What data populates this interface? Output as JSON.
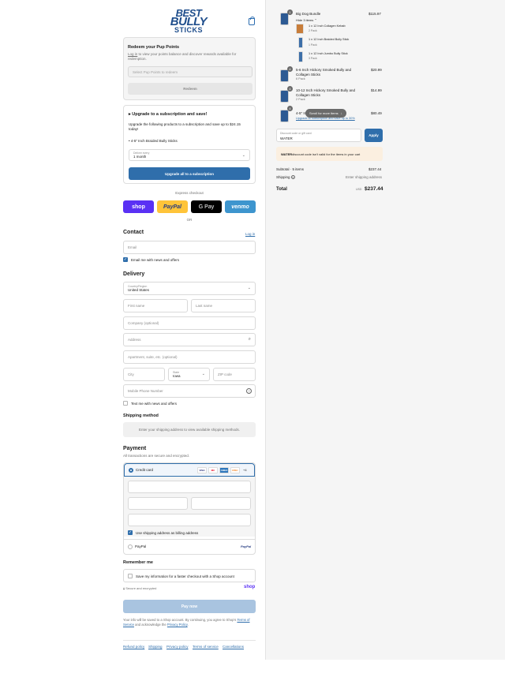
{
  "brand": {
    "line1": "BEST",
    "line2": "BULLY",
    "line3": "STICKS"
  },
  "points": {
    "title": "Redeem your Pup Points",
    "login_link": "Log in",
    "desc_rest": " to view your points balance and discover rewards available for redemption.",
    "select_placeholder": "Select Pup Points to redeem",
    "redeem_label": "Redeem"
  },
  "subscription": {
    "title": "Upgrade to a subscription and save!",
    "desc": "Upgrade the following products to a subscription and save up to $24.15 today!",
    "item": "4-5\" Inch Braided Bully Sticks",
    "delivery_label": "Deliver every",
    "delivery_value": "1 month",
    "button_label": "Upgrade all to a subscription"
  },
  "express": {
    "label": "Express checkout",
    "shop": "shop",
    "paypal": "PayPal",
    "gpay": "G Pay",
    "venmo": "venmo",
    "or": "OR"
  },
  "contact": {
    "title": "Contact",
    "login_link": "Log in",
    "email_placeholder": "Email",
    "news_label": "Email me with news and offers"
  },
  "delivery": {
    "title": "Delivery",
    "country_label": "Country/Region",
    "country_value": "United States",
    "first_name": "First name",
    "last_name": "Last name",
    "company": "Company (optional)",
    "address": "Address",
    "apartment": "Apartment, suite, etc. (optional)",
    "city": "City",
    "state_label": "State",
    "state_value": "Iowa",
    "zip": "ZIP code",
    "phone": "Mobile Phone Number",
    "text_label": "Text me with news and offers"
  },
  "shipping_method": {
    "title": "Shipping method",
    "message": "Enter your shipping address to view available shipping methods."
  },
  "payment": {
    "title": "Payment",
    "subtitle": "All transactions are secure and encrypted.",
    "credit_card": "Credit card",
    "cards": [
      "VISA",
      "MC",
      "AMEX",
      "DISC",
      "+4"
    ],
    "billing_label": "Use shipping address as billing address",
    "paypal": "PayPal",
    "paypal_logo": "PayPal"
  },
  "remember": {
    "title": "Remember me",
    "save_label": "Save my information for a faster checkout with a Shop account",
    "secure": "Secure and encrypted",
    "shop": "shop"
  },
  "pay_now": "Pay now",
  "legal": {
    "text_pre": "Your info will be saved to a Shop account. By continuing, you agree to Shop's ",
    "terms": "Terms of Service",
    "text_mid": " and acknowledge the ",
    "privacy": "Privacy Policy",
    "text_end": "."
  },
  "footer": [
    "Refund policy",
    "Shipping",
    "Privacy policy",
    "Terms of service",
    "Cancellations"
  ],
  "summary": {
    "items": [
      {
        "qty": "1",
        "name": "Big Dog Bundle",
        "price": "$115.97",
        "sub": "Hide 3 items"
      },
      {
        "qty": "4",
        "name": "5-6 Inch Hickory Smoked Bully and Collagen Sticks",
        "sub": "6 Pack",
        "price": "$20.99"
      },
      {
        "qty": "4",
        "name": "10-12 Inch Hickory Smoked Bully and Collagen Sticks",
        "sub": "2 Pack",
        "price": "$14.99"
      },
      {
        "qty": "4",
        "name": "4-5\" In",
        "price": "$80.49",
        "link": "Upgrade to subscription and save up to 30%"
      }
    ],
    "bundle_children": [
      {
        "name": "1 x 12 Inch Collagen Kebab",
        "sub": "2 Pack"
      },
      {
        "name": "1 x 12 Inch Braided Bully Stick",
        "sub": "1 Pack"
      },
      {
        "name": "1 x 12 Inch Jumbo Bully Stick",
        "sub": "3 Pack"
      }
    ],
    "scroll_hint": "Scroll for more items",
    "discount_label": "Discount code or gift card",
    "discount_value": "WATER",
    "apply": "Apply",
    "warning_code": "WATER",
    "warning_text": " discount code isn't valid for the items in your cart",
    "subtotal_label": "Subtotal · 5 items",
    "subtotal_value": "$237.44",
    "shipping_label": "Shipping",
    "shipping_value": "Enter shipping address",
    "total_label": "Total",
    "currency": "USD",
    "total_value": "$237.44"
  }
}
